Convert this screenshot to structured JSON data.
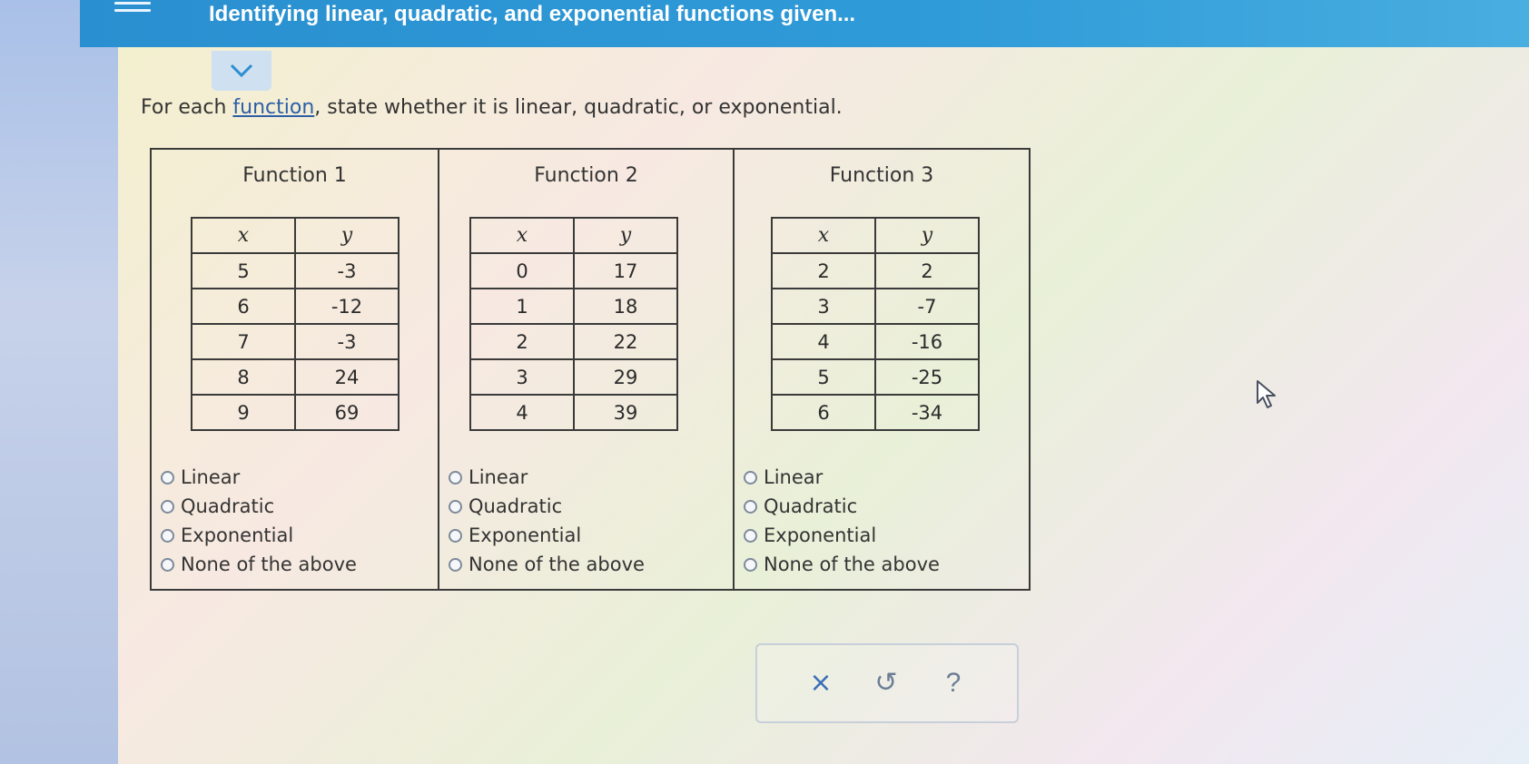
{
  "header": {
    "title": "Identifying linear, quadratic, and exponential functions given..."
  },
  "prompt": {
    "before": "For each ",
    "link": "function",
    "after": ", state whether it is linear, quadratic, or exponential."
  },
  "functions": [
    {
      "title": "Function 1",
      "x_header": "x",
      "y_header": "y",
      "rows": [
        [
          "5",
          "-3"
        ],
        [
          "6",
          "-12"
        ],
        [
          "7",
          "-3"
        ],
        [
          "8",
          "24"
        ],
        [
          "9",
          "69"
        ]
      ],
      "options": [
        "Linear",
        "Quadratic",
        "Exponential",
        "None of the above"
      ]
    },
    {
      "title": "Function 2",
      "x_header": "x",
      "y_header": "y",
      "rows": [
        [
          "0",
          "17"
        ],
        [
          "1",
          "18"
        ],
        [
          "2",
          "22"
        ],
        [
          "3",
          "29"
        ],
        [
          "4",
          "39"
        ]
      ],
      "options": [
        "Linear",
        "Quadratic",
        "Exponential",
        "None of the above"
      ]
    },
    {
      "title": "Function 3",
      "x_header": "x",
      "y_header": "y",
      "rows": [
        [
          "2",
          "2"
        ],
        [
          "3",
          "-7"
        ],
        [
          "4",
          "-16"
        ],
        [
          "5",
          "-25"
        ],
        [
          "6",
          "-34"
        ]
      ],
      "options": [
        "Linear",
        "Quadratic",
        "Exponential",
        "None of the above"
      ]
    }
  ],
  "toolbar": {
    "clear": "×",
    "undo": "↺",
    "help": "?"
  },
  "icons": {
    "menu": "menu-icon",
    "collapse": "chevron-down-icon",
    "cursor": "mouse-pointer-icon"
  }
}
